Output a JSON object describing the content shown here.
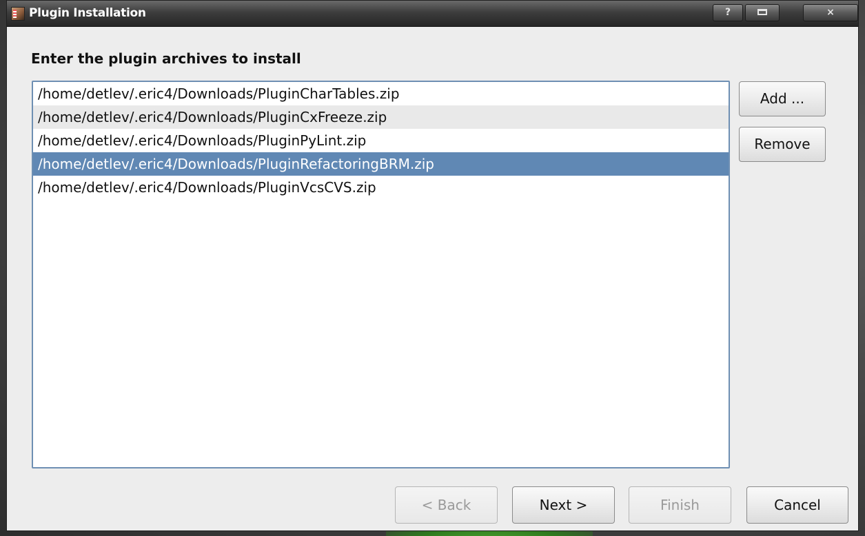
{
  "window": {
    "title": "Plugin Installation"
  },
  "titlebar": {
    "help_label": "?",
    "close_label": "×"
  },
  "page": {
    "heading": "Enter the plugin archives to install"
  },
  "archives": {
    "selected_index": 3,
    "items": [
      "/home/detlev/.eric4/Downloads/PluginCharTables.zip",
      "/home/detlev/.eric4/Downloads/PluginCxFreeze.zip",
      "/home/detlev/.eric4/Downloads/PluginPyLint.zip",
      "/home/detlev/.eric4/Downloads/PluginRefactoringBRM.zip",
      "/home/detlev/.eric4/Downloads/PluginVcsCVS.zip"
    ]
  },
  "side_buttons": {
    "add_label": "Add ...",
    "remove_label": "Remove"
  },
  "wizard_buttons": {
    "back_label": "< Back",
    "next_label": "Next >",
    "finish_label": "Finish",
    "cancel_label": "Cancel",
    "back_enabled": false,
    "finish_enabled": false
  },
  "colors": {
    "selection": "#6088b4",
    "list_border": "#6e8fb3",
    "dialog_bg": "#ededed",
    "titlebar_text": "#ffffff"
  }
}
